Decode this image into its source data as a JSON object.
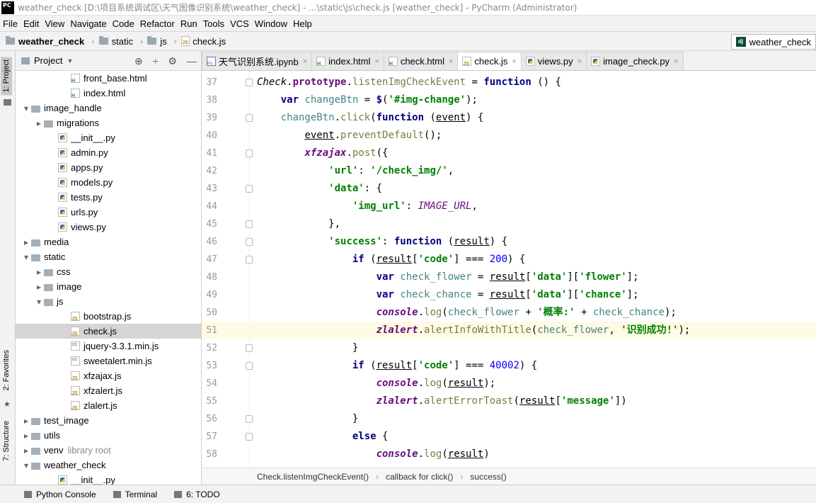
{
  "window": {
    "title": "weather_check [D:\\项目系统调试区\\天气图像识别系统\\weather_check] - ...\\static\\js\\check.js [weather_check] - PyCharm (Administrator)",
    "logo": "PC"
  },
  "menu": [
    "File",
    "Edit",
    "View",
    "Navigate",
    "Code",
    "Refactor",
    "Run",
    "Tools",
    "VCS",
    "Window",
    "Help"
  ],
  "breadcrumbs": [
    "weather_check",
    "static",
    "js",
    "check.js"
  ],
  "project_selector": "weather_check",
  "left_strip": {
    "project_tab": "1: Project",
    "favorites_tab": "2: Favorites",
    "structure_tab": "7: Structure"
  },
  "project_panel": {
    "title": "Project",
    "tree": [
      {
        "label": "front_base.html",
        "type": "html",
        "indent": 4
      },
      {
        "label": "index.html",
        "type": "html",
        "indent": 4
      },
      {
        "label": "image_handle",
        "type": "folder",
        "indent": 1,
        "arrow": "open"
      },
      {
        "label": "migrations",
        "type": "folder",
        "indent": 2,
        "arrow": "closed"
      },
      {
        "label": "__init__.py",
        "type": "py",
        "indent": 3
      },
      {
        "label": "admin.py",
        "type": "py",
        "indent": 3
      },
      {
        "label": "apps.py",
        "type": "py",
        "indent": 3
      },
      {
        "label": "models.py",
        "type": "py",
        "indent": 3
      },
      {
        "label": "tests.py",
        "type": "py",
        "indent": 3
      },
      {
        "label": "urls.py",
        "type": "py",
        "indent": 3
      },
      {
        "label": "views.py",
        "type": "py",
        "indent": 3
      },
      {
        "label": "media",
        "type": "folder",
        "indent": 1,
        "arrow": "closed"
      },
      {
        "label": "static",
        "type": "folder",
        "indent": 1,
        "arrow": "open"
      },
      {
        "label": "css",
        "type": "folder",
        "indent": 2,
        "arrow": "closed"
      },
      {
        "label": "image",
        "type": "folder",
        "indent": 2,
        "arrow": "closed"
      },
      {
        "label": "js",
        "type": "folder",
        "indent": 2,
        "arrow": "open"
      },
      {
        "label": "bootstrap.js",
        "type": "js",
        "indent": 4
      },
      {
        "label": "check.js",
        "type": "js",
        "indent": 4,
        "selected": true
      },
      {
        "label": "jquery-3.3.1.min.js",
        "type": "min",
        "indent": 4
      },
      {
        "label": "sweetalert.min.js",
        "type": "min",
        "indent": 4
      },
      {
        "label": "xfzajax.js",
        "type": "js",
        "indent": 4
      },
      {
        "label": "xfzalert.js",
        "type": "js",
        "indent": 4
      },
      {
        "label": "zlalert.js",
        "type": "js",
        "indent": 4
      },
      {
        "label": "test_image",
        "type": "folder",
        "indent": 1,
        "arrow": "closed"
      },
      {
        "label": "utils",
        "type": "folder",
        "indent": 1,
        "arrow": "closed"
      },
      {
        "label": "venv",
        "type": "folder",
        "indent": 1,
        "arrow": "closed",
        "note": "library root"
      },
      {
        "label": "weather_check",
        "type": "folder",
        "indent": 1,
        "arrow": "open"
      },
      {
        "label": "__init__.py",
        "type": "py",
        "indent": 3
      }
    ]
  },
  "editor_tabs": [
    {
      "label": "天气识别系统.ipynb",
      "type": "nb"
    },
    {
      "label": "index.html",
      "type": "html"
    },
    {
      "label": "check.html",
      "type": "html"
    },
    {
      "label": "check.js",
      "type": "js",
      "active": true
    },
    {
      "label": "views.py",
      "type": "py"
    },
    {
      "label": "image_check.py",
      "type": "py"
    }
  ],
  "code": {
    "current_line": 51,
    "lines": [
      {
        "n": "37",
        "fold": true,
        "html": "<span class=\"cls\">Check</span>.<span class=\"proto\">prototype</span>.<span class=\"method\">listenImgCheckEvent</span> = <span class=\"kw\">function</span> () {"
      },
      {
        "n": "38",
        "fold": false,
        "html": "    <span class=\"kw\">var</span> <span class=\"var\">changeBtn</span> = <span class=\"kw\">$</span>(<span class=\"str\">'#img-change'</span>);"
      },
      {
        "n": "39",
        "fold": true,
        "html": "    <span class=\"var\">changeBtn</span>.<span class=\"method\">click</span>(<span class=\"kw\">function</span> (<span class=\"param\">event</span>) {"
      },
      {
        "n": "40",
        "fold": false,
        "html": "        <span class=\"param\">event</span>.<span class=\"method\">preventDefault</span>();"
      },
      {
        "n": "41",
        "fold": true,
        "html": "        <span class=\"glob\">xfzajax</span>.<span class=\"method\">post</span>({"
      },
      {
        "n": "42",
        "fold": false,
        "html": "            <span class=\"str\">'url'</span>: <span class=\"str\">'/check_img/'</span>,"
      },
      {
        "n": "43",
        "fold": true,
        "html": "            <span class=\"str\">'data'</span>: {"
      },
      {
        "n": "44",
        "fold": false,
        "html": "                <span class=\"str\">'img_url'</span>: <span class=\"prop\">IMAGE_URL</span>,"
      },
      {
        "n": "45",
        "fold": true,
        "html": "            },"
      },
      {
        "n": "46",
        "fold": true,
        "html": "            <span class=\"str\">'success'</span>: <span class=\"kw\">function</span> (<span class=\"param\">result</span>) {"
      },
      {
        "n": "47",
        "fold": true,
        "html": "                <span class=\"kw\">if</span> (<span class=\"param\">result</span>[<span class=\"str\">'code'</span>] === <span class=\"num\">200</span>) {"
      },
      {
        "n": "48",
        "fold": false,
        "html": "                    <span class=\"kw\">var</span> <span class=\"var\">check_flower</span> = <span class=\"param\">result</span>[<span class=\"str\">'data'</span>][<span class=\"str\">'flower'</span>];"
      },
      {
        "n": "49",
        "fold": false,
        "html": "                    <span class=\"kw\">var</span> <span class=\"var\">check_chance</span> = <span class=\"param\">result</span>[<span class=\"str\">'data'</span>][<span class=\"str\">'chance'</span>];"
      },
      {
        "n": "50",
        "fold": false,
        "html": "                    <span class=\"glob\">console</span>.<span class=\"method\">log</span>(<span class=\"var\">check_flower</span> + <span class=\"str\">'概率:'</span> + <span class=\"var\">check_chance</span>);"
      },
      {
        "n": "51",
        "fold": false,
        "html": "                    <span class=\"glob\">zlalert</span>.<span class=\"method\">alertInfoWithTitle</span>(<span class=\"var\">check_flower</span>, <span class=\"str\">'识别成功!'</span>);"
      },
      {
        "n": "52",
        "fold": true,
        "html": "                }"
      },
      {
        "n": "53",
        "fold": true,
        "html": "                <span class=\"kw\">if</span> (<span class=\"param\">result</span>[<span class=\"str\">'code'</span>] === <span class=\"num\">40002</span>) {"
      },
      {
        "n": "54",
        "fold": false,
        "html": "                    <span class=\"glob\">console</span>.<span class=\"method\">log</span>(<span class=\"param\">result</span>);"
      },
      {
        "n": "55",
        "fold": false,
        "html": "                    <span class=\"glob\">zlalert</span>.<span class=\"method\">alertErrorToast</span>(<span class=\"param\">result</span>[<span class=\"str\">'message'</span>])"
      },
      {
        "n": "56",
        "fold": true,
        "html": "                }"
      },
      {
        "n": "57",
        "fold": true,
        "html": "                <span class=\"kw\">else</span> {"
      },
      {
        "n": "58",
        "fold": false,
        "html": "                    <span class=\"glob\">console</span>.<span class=\"method\">log</span>(<span class=\"param\">result</span>)"
      }
    ]
  },
  "editor_breadcrumbs": [
    "Check.listenImgCheckEvent()",
    "callback for click()",
    "success()"
  ],
  "bottom_tools": [
    "Python Console",
    "Terminal",
    "6: TODO"
  ]
}
